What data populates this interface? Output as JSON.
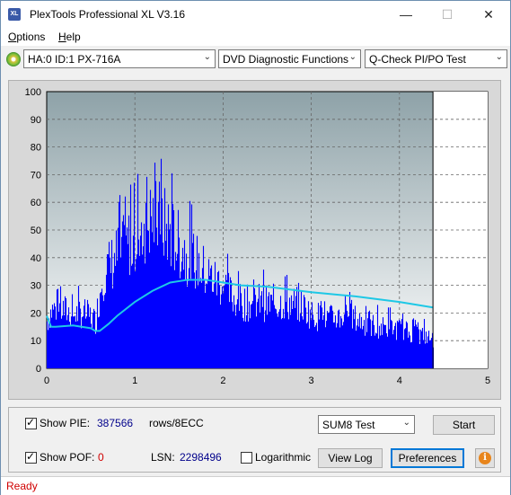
{
  "window": {
    "title": "PlexTools Professional XL V3.16",
    "icon_text": "XL"
  },
  "menu": [
    {
      "label": "Options",
      "mnemonic": "O",
      "rest": "ptions"
    },
    {
      "label": "Help",
      "mnemonic": "H",
      "rest": "elp"
    }
  ],
  "toolbar": {
    "drive": "HA:0 ID:1  PX-716A",
    "function": "DVD Diagnostic Functions",
    "test": "Q-Check PI/PO Test"
  },
  "chart_data": {
    "type": "area",
    "title": "",
    "xlabel": "",
    "ylabel": "",
    "xlim": [
      0,
      5
    ],
    "ylim": [
      0,
      100
    ],
    "x_ticks": [
      "0",
      "1",
      "2",
      "3",
      "4",
      "5"
    ],
    "y_ticks": [
      "0",
      "10",
      "20",
      "30",
      "40",
      "50",
      "60",
      "70",
      "80",
      "90",
      "100"
    ],
    "grid": true,
    "data_end_x": 4.38,
    "colors": {
      "pie_fill": "#0000ff",
      "avg_line": "#1ec8e6",
      "plot_bg_top": "#8ea2a8",
      "plot_bg_bottom": "#ffffff"
    },
    "series": [
      {
        "kind": "pie_envelope",
        "x": [
          0.0,
          0.05,
          0.1,
          0.2,
          0.3,
          0.4,
          0.5,
          0.55,
          0.6,
          0.62,
          0.65,
          0.7,
          0.8,
          0.9,
          1.0,
          1.1,
          1.2,
          1.3,
          1.4,
          1.5,
          1.6,
          1.7,
          1.8,
          1.9,
          2.0,
          2.1,
          2.2,
          2.3,
          2.4,
          2.5,
          2.6,
          2.7,
          2.8,
          2.9,
          3.0,
          3.1,
          3.2,
          3.3,
          3.4,
          3.5,
          3.6,
          3.7,
          3.8,
          3.9,
          4.0,
          4.1,
          4.2,
          4.3,
          4.38
        ],
        "values": [
          22,
          27,
          28,
          27,
          25,
          26,
          24,
          22,
          35,
          42,
          45,
          47,
          53,
          57,
          62,
          67,
          70,
          68,
          63,
          57,
          53,
          49,
          44,
          41,
          39,
          33,
          31,
          30,
          31,
          30,
          30,
          31,
          30,
          29,
          25,
          24,
          23,
          24,
          25,
          23,
          21,
          20,
          19,
          19,
          18,
          17,
          16,
          15,
          13
        ]
      },
      {
        "kind": "average_line",
        "x": [
          0.0,
          0.05,
          0.1,
          0.3,
          0.5,
          0.55,
          0.6,
          0.7,
          0.8,
          1.0,
          1.2,
          1.4,
          1.6,
          1.8,
          2.0,
          2.2,
          2.5,
          3.0,
          3.5,
          4.0,
          4.38
        ],
        "values": [
          19,
          15,
          15,
          15.5,
          14.5,
          13.5,
          13.5,
          16,
          19,
          24,
          28,
          31,
          32,
          32,
          31,
          30,
          29.5,
          27.5,
          26,
          24,
          22
        ]
      }
    ]
  },
  "panel": {
    "show_pie_label": "Show PIE:",
    "pie_value": "387566",
    "rows_label": "rows/8ECC",
    "show_pof_label": "Show POF:",
    "pof_value": "0",
    "lsn_label": "LSN:",
    "lsn_value": "2298496",
    "log_label": "Logarithmic",
    "sum_select": "SUM8 Test",
    "start_btn": "Start",
    "viewlog_btn": "View Log",
    "prefs_btn": "Preferences"
  },
  "status": {
    "text": "Ready"
  }
}
